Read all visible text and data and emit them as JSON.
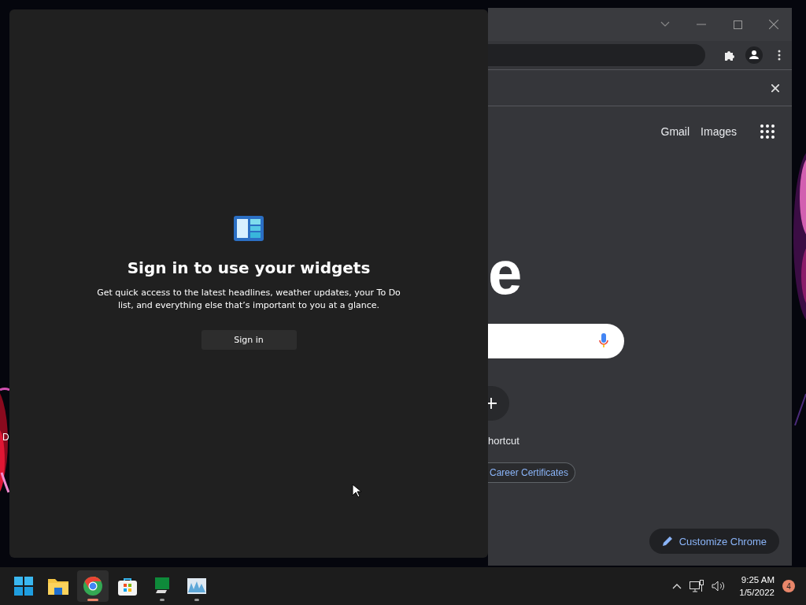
{
  "desktop": {
    "icon_label": "D"
  },
  "browser": {
    "links": [
      "Gmail",
      "Images"
    ],
    "logo_fragment": "e",
    "shortcut_label": "hortcut",
    "chip": "Career Certificates",
    "customize_button": "Customize Chrome"
  },
  "widgets": {
    "title": "Sign in to use your widgets",
    "description": "Get quick access to the latest headlines, weather updates, your To Do list, and everything else that’s important to you at a glance.",
    "button": "Sign in"
  },
  "taskbar": {
    "apps": [
      {
        "kind": "start",
        "running": false,
        "selected": false
      },
      {
        "kind": "folder",
        "running": false,
        "selected": false
      },
      {
        "kind": "browser",
        "running": true,
        "selected": true
      },
      {
        "kind": "store",
        "running": false,
        "selected": false
      },
      {
        "kind": "monitor",
        "running": true,
        "selected": false
      },
      {
        "kind": "chart",
        "running": true,
        "selected": false
      }
    ],
    "time": "9:25 AM",
    "date": "1/5/2022",
    "notification_count": "4"
  }
}
